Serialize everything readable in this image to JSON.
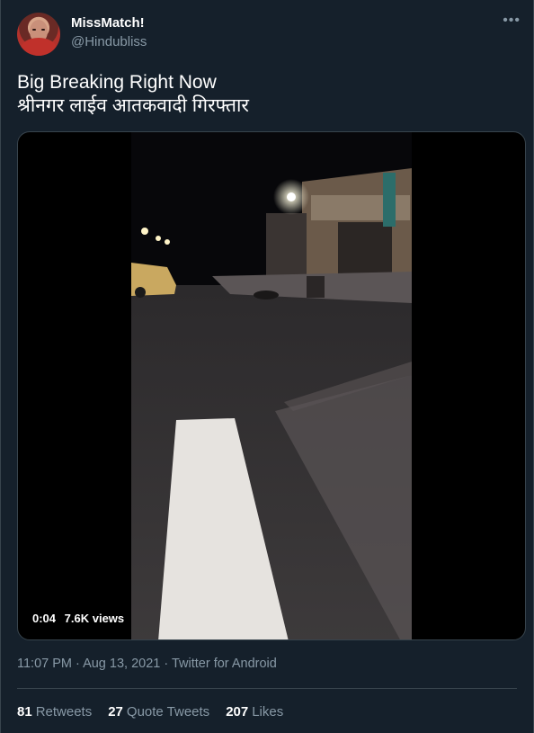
{
  "user": {
    "display_name": "MissMatch!",
    "handle": "@Hindubliss"
  },
  "more_icon": "more-options-icon",
  "tweet": {
    "line1": "Big Breaking Right Now",
    "line2": "श्रीनगर लाईव आतकवादी गिरफ्तार"
  },
  "video": {
    "duration": "0:04",
    "views": "7.6K views"
  },
  "meta": {
    "timestamp": "11:07 PM · Aug 13, 2021 · Twitter for Android"
  },
  "stats": {
    "retweets_count": "81",
    "retweets_label": "Retweets",
    "quote_count": "27",
    "quote_label": "Quote Tweets",
    "likes_count": "207",
    "likes_label": "Likes"
  },
  "colors": {
    "background": "#15202b",
    "secondary_text": "#8899a6",
    "border": "#38444d"
  }
}
